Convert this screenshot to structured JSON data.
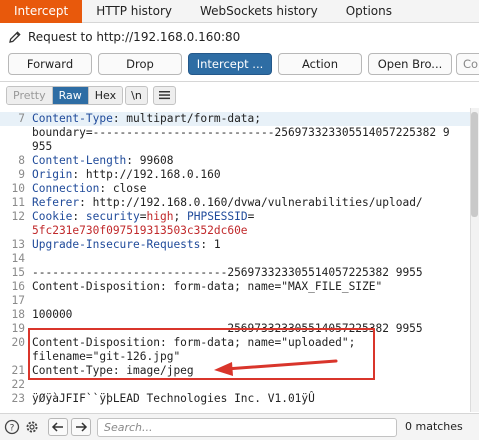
{
  "tabs": [
    {
      "label": "Intercept",
      "active": true
    },
    {
      "label": "HTTP history",
      "active": false
    },
    {
      "label": "WebSockets history",
      "active": false
    },
    {
      "label": "Options",
      "active": false
    }
  ],
  "request_line": "Request to http://192.168.0.160:80",
  "toolbar": {
    "forward": "Forward",
    "drop": "Drop",
    "intercept": "Intercept ...",
    "action": "Action",
    "open_browser": "Open Bro...",
    "comment_placeholder": "Co"
  },
  "view_buttons": {
    "pretty": "Pretty",
    "raw": "Raw",
    "hex": "Hex",
    "newline": "\\n",
    "menu_icon": "hamburger-icon"
  },
  "lines": [
    {
      "num": "7",
      "segments": [
        {
          "t": "Content-Type",
          "c": "k"
        },
        {
          "t": ": multipart/form-data;",
          "c": "v"
        }
      ],
      "hl": true
    },
    {
      "num": "",
      "segments": [
        {
          "t": "boundary=---------------------------256973323305514057225382 9",
          "c": "v"
        }
      ]
    },
    {
      "num": "",
      "segments": [
        {
          "t": "955",
          "c": "v"
        }
      ]
    },
    {
      "num": "8",
      "segments": [
        {
          "t": "Content-Length",
          "c": "k"
        },
        {
          "t": ": 99608",
          "c": "v"
        }
      ]
    },
    {
      "num": "9",
      "segments": [
        {
          "t": "Origin",
          "c": "k"
        },
        {
          "t": ": http://192.168.0.160",
          "c": "v"
        }
      ]
    },
    {
      "num": "10",
      "segments": [
        {
          "t": "Connection",
          "c": "k"
        },
        {
          "t": ": close",
          "c": "v"
        }
      ]
    },
    {
      "num": "11",
      "segments": [
        {
          "t": "Referer",
          "c": "k"
        },
        {
          "t": ": http://192.168.0.160/dvwa/vulnerabilities/upload/",
          "c": "v"
        }
      ]
    },
    {
      "num": "12",
      "segments": [
        {
          "t": "Cookie",
          "c": "k"
        },
        {
          "t": ": ",
          "c": "v"
        },
        {
          "t": "security",
          "c": "k"
        },
        {
          "t": "=",
          "c": "v"
        },
        {
          "t": "high",
          "c": "r"
        },
        {
          "t": "; ",
          "c": "v"
        },
        {
          "t": "PHPSESSID",
          "c": "k"
        },
        {
          "t": "=",
          "c": "v"
        }
      ]
    },
    {
      "num": "",
      "segments": [
        {
          "t": "5fc231e730f097519313503c352dc60e",
          "c": "r"
        }
      ]
    },
    {
      "num": "13",
      "segments": [
        {
          "t": "Upgrade-Insecure-Requests",
          "c": "k"
        },
        {
          "t": ": 1",
          "c": "v"
        }
      ]
    },
    {
      "num": "14",
      "segments": []
    },
    {
      "num": "15",
      "segments": [
        {
          "t": "-----------------------------256973323305514057225382 9955",
          "c": "v"
        }
      ]
    },
    {
      "num": "16",
      "segments": [
        {
          "t": "Content-Disposition: form-data; name=\"MAX_FILE_SIZE\"",
          "c": "v"
        }
      ]
    },
    {
      "num": "17",
      "segments": []
    },
    {
      "num": "18",
      "segments": [
        {
          "t": "100000",
          "c": "v"
        }
      ]
    },
    {
      "num": "19",
      "segments": [
        {
          "t": "-----------------------------256973323305514057225382 9955",
          "c": "v"
        }
      ]
    },
    {
      "num": "20",
      "segments": [
        {
          "t": "Content-Disposition: form-data; name=\"uploaded\";",
          "c": "v"
        }
      ]
    },
    {
      "num": "",
      "segments": [
        {
          "t": "filename=\"git-126.jpg\"",
          "c": "v"
        }
      ]
    },
    {
      "num": "21",
      "segments": [
        {
          "t": "Content-Type: image/jpeg",
          "c": "v"
        }
      ]
    },
    {
      "num": "22",
      "segments": []
    },
    {
      "num": "23",
      "segments": [
        {
          "t": "ÿØÿàJFIF``ÿþLEAD Technologies Inc. V1.01ÿÛ",
          "c": "v"
        }
      ]
    }
  ],
  "footer": {
    "help_icon": "help-icon",
    "settings_icon": "gear-icon",
    "back_icon": "arrow-left-icon",
    "forward_icon": "arrow-right-icon",
    "search_placeholder": "Search...",
    "matches": "0 matches"
  },
  "colors": {
    "accent": "#e8590c",
    "primary_button": "#2e6da4",
    "annotation_red": "#d9352b",
    "header_key": "#1f4a9a",
    "value_red": "#c0282a"
  }
}
